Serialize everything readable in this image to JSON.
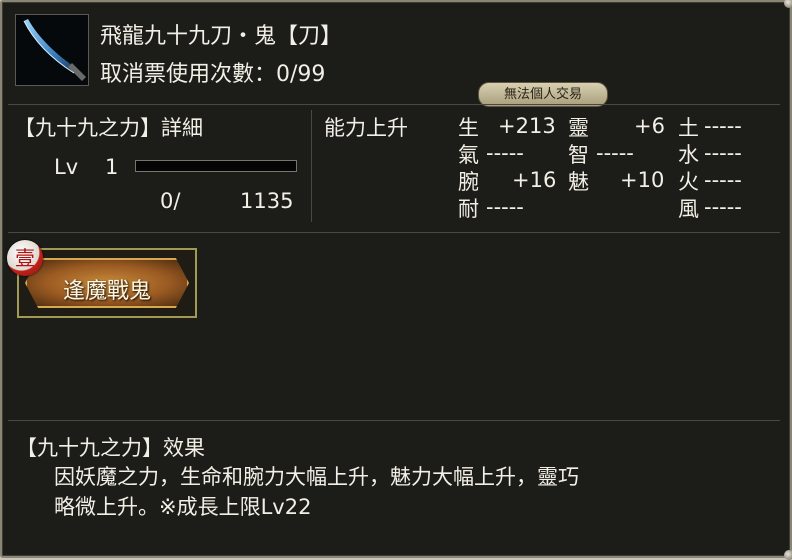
{
  "item": {
    "title": "飛龍九十九刀・鬼【刀】",
    "uses": "取消票使用次數：0/99",
    "trade_badge": "無法個人交易",
    "icon": "curved-blade-icon"
  },
  "detail": {
    "title": "【九十九之力】詳細",
    "lv_label": "Lv",
    "lv_value": "1",
    "exp_current": "0/",
    "exp_max": "1135",
    "exp_progress": 0
  },
  "abilities": {
    "title": "能力上升",
    "stats": [
      {
        "name": "生",
        "value": "+213"
      },
      {
        "name": "氣",
        "value": "-----"
      },
      {
        "name": "腕",
        "value": "+16"
      },
      {
        "name": "耐",
        "value": "-----"
      },
      {
        "name": "靈",
        "value": "+6"
      },
      {
        "name": "智",
        "value": "-----"
      },
      {
        "name": "魅",
        "value": "+10"
      },
      {
        "name": "土",
        "value": "-----"
      },
      {
        "name": "水",
        "value": "-----"
      },
      {
        "name": "火",
        "value": "-----"
      },
      {
        "name": "風",
        "value": "-----"
      }
    ]
  },
  "skill": {
    "badge": "壹",
    "label": "逢魔戰鬼"
  },
  "effect": {
    "title": "【九十九之力】效果",
    "line1": "因妖魔之力，生命和腕力大幅上升，魅力大幅上升，靈巧",
    "line2": "略微上升。※成長上限Lv22"
  },
  "colors": {
    "panel_bg": "#1c1c18",
    "text": "#f2efe6",
    "border_gold": "#a29a52"
  }
}
